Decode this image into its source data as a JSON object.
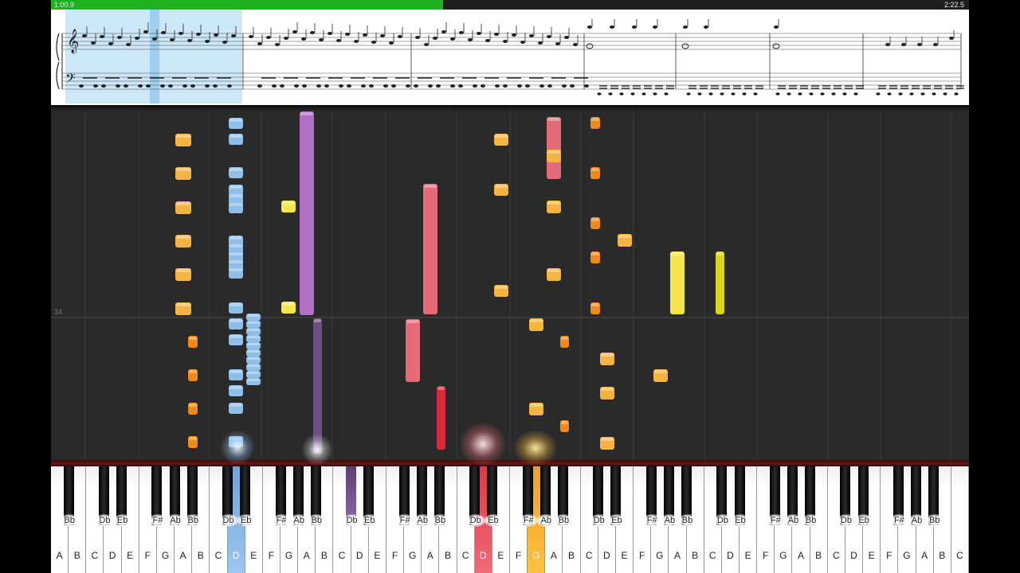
{
  "player": {
    "elapsed": "1:00.9",
    "total": "2:22.5",
    "progress": 0.427,
    "measure_label": "34"
  },
  "colors": {
    "progress": "#1fb21f",
    "background": "#2a2a2a",
    "blue": "#8fbfe8",
    "orange": "#f5b442",
    "dark_orange": "#ee8a1a",
    "yellow": "#f3e54a",
    "purple": "#b26fc4",
    "dark_purple": "#6e4d84",
    "pink": "#e76a78",
    "red": "#d9283a",
    "selection": "#cce8f8"
  },
  "keyboard": {
    "white_labels": [
      "A",
      "B",
      "C",
      "D",
      "E",
      "F",
      "G",
      "A",
      "B",
      "C",
      "D",
      "E",
      "F",
      "G",
      "A",
      "B",
      "C",
      "D",
      "E",
      "F",
      "G",
      "A",
      "B",
      "C",
      "D",
      "E",
      "F",
      "G",
      "A",
      "B",
      "C",
      "D",
      "E",
      "F",
      "G",
      "A",
      "B",
      "C",
      "D",
      "E",
      "F",
      "G",
      "A",
      "B",
      "C",
      "D",
      "E",
      "F",
      "G",
      "A",
      "B",
      "C"
    ],
    "black_labels": [
      "Bb",
      "Db",
      "Eb",
      "F#",
      "Ab",
      "Bb",
      "Db",
      "Eb",
      "F#",
      "Ab",
      "Bb",
      "Db",
      "Eb",
      "F#",
      "Ab",
      "Bb",
      "Db",
      "Eb",
      "F#",
      "Ab",
      "Bb",
      "Db",
      "Eb",
      "F#",
      "Ab",
      "Bb",
      "Db",
      "Eb",
      "F#",
      "Ab",
      "Bb",
      "Db",
      "Eb",
      "F#",
      "Ab",
      "Bb"
    ],
    "pressed": {
      "blue_white": [
        10
      ],
      "red_white": [
        24
      ],
      "orange_white": [
        27
      ],
      "purple_black": [
        11
      ]
    }
  }
}
